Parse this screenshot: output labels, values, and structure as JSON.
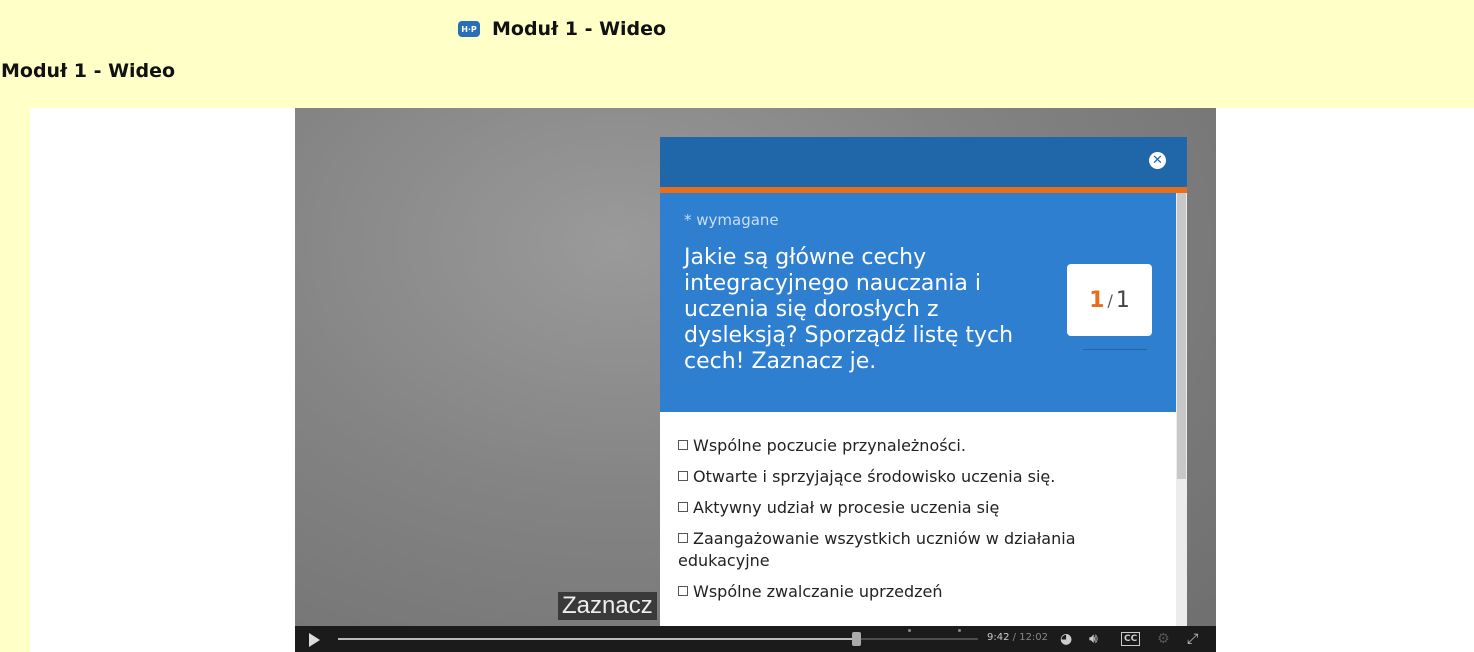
{
  "page": {
    "top_title": "Moduł 1 - Wideo",
    "top_icon_label": "H·P",
    "heading": "Moduł 1 - Wideo"
  },
  "video": {
    "subtitle": "Zaznacz",
    "played_fraction": 0.81,
    "controls": {
      "current_time": "9:42",
      "duration": "/ 12:02",
      "cc_label": "CC"
    }
  },
  "dialog": {
    "required_note": "* wymagane",
    "question": "Jakie są główne cechy integracyjnego nauczania i uczenia się dorosłych z dysleksją? Sporządź listę tych cech! Zaznacz je.",
    "counter": {
      "current": "1",
      "separator": "/",
      "total": "1"
    },
    "options": [
      "Wspólne poczucie przynależności.",
      "Otwarte i sprzyjające środowisko uczenia się.",
      "Aktywny udział w procesie uczenia się",
      "Zaangażowanie wszystkich uczniów w działania edukacyjne",
      "Wspólne zwalczanie uprzedzeń"
    ]
  },
  "icons": {
    "close": "close-icon",
    "play": "play-icon",
    "speed": "playback-rate-icon",
    "volume": "volume-icon",
    "captions": "captions-icon",
    "settings": "gear-icon",
    "fullscreen": "fullscreen-icon"
  },
  "colors": {
    "page_background": "#ffffc8",
    "dialog_header": "#1f67a8",
    "accent_orange": "#e86e1c",
    "question_background": "#2f7fd0"
  }
}
